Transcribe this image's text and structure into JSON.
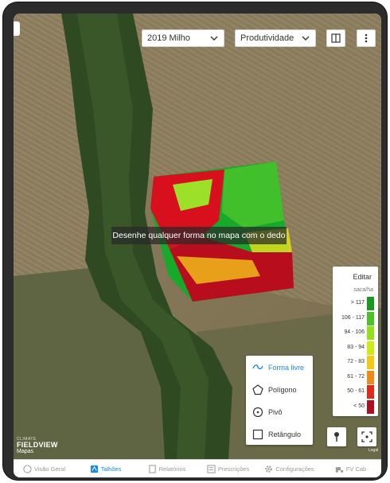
{
  "header": {
    "season_select": "2019 Milho",
    "layer_select": "Produtividade"
  },
  "toast": "Desenhe qualquer forma no mapa com o dedo",
  "legend": {
    "edit_label": "Editar",
    "unit": "saca/ha",
    "ranges": [
      {
        "label": "> 117",
        "color": "#1a9a1a"
      },
      {
        "label": "106 - 117",
        "color": "#4cc22a"
      },
      {
        "label": "94 - 106",
        "color": "#94e01c"
      },
      {
        "label": "83 - 94",
        "color": "#ccec18"
      },
      {
        "label": "72 - 83",
        "color": "#f5c817"
      },
      {
        "label": "61 - 72",
        "color": "#f08a1c"
      },
      {
        "label": "50 - 61",
        "color": "#e02a1a"
      },
      {
        "label": "< 50",
        "color": "#b0101e"
      }
    ]
  },
  "draw_menu": {
    "freeform": "Forma livre",
    "polygon": "Polígono",
    "pivot": "Pivô",
    "rectangle": "Retângulo"
  },
  "branding": {
    "top": "CLIMATE",
    "name": "FIELDVIEW",
    "maps": "Mapas",
    "legal": "Legal"
  },
  "tabs": {
    "overview": "Visão Geral",
    "fields": "Talhões",
    "reports": "Relatórios",
    "prescriptions": "Prescrições",
    "settings": "Configurações",
    "fv_cab": "FV Cab"
  }
}
